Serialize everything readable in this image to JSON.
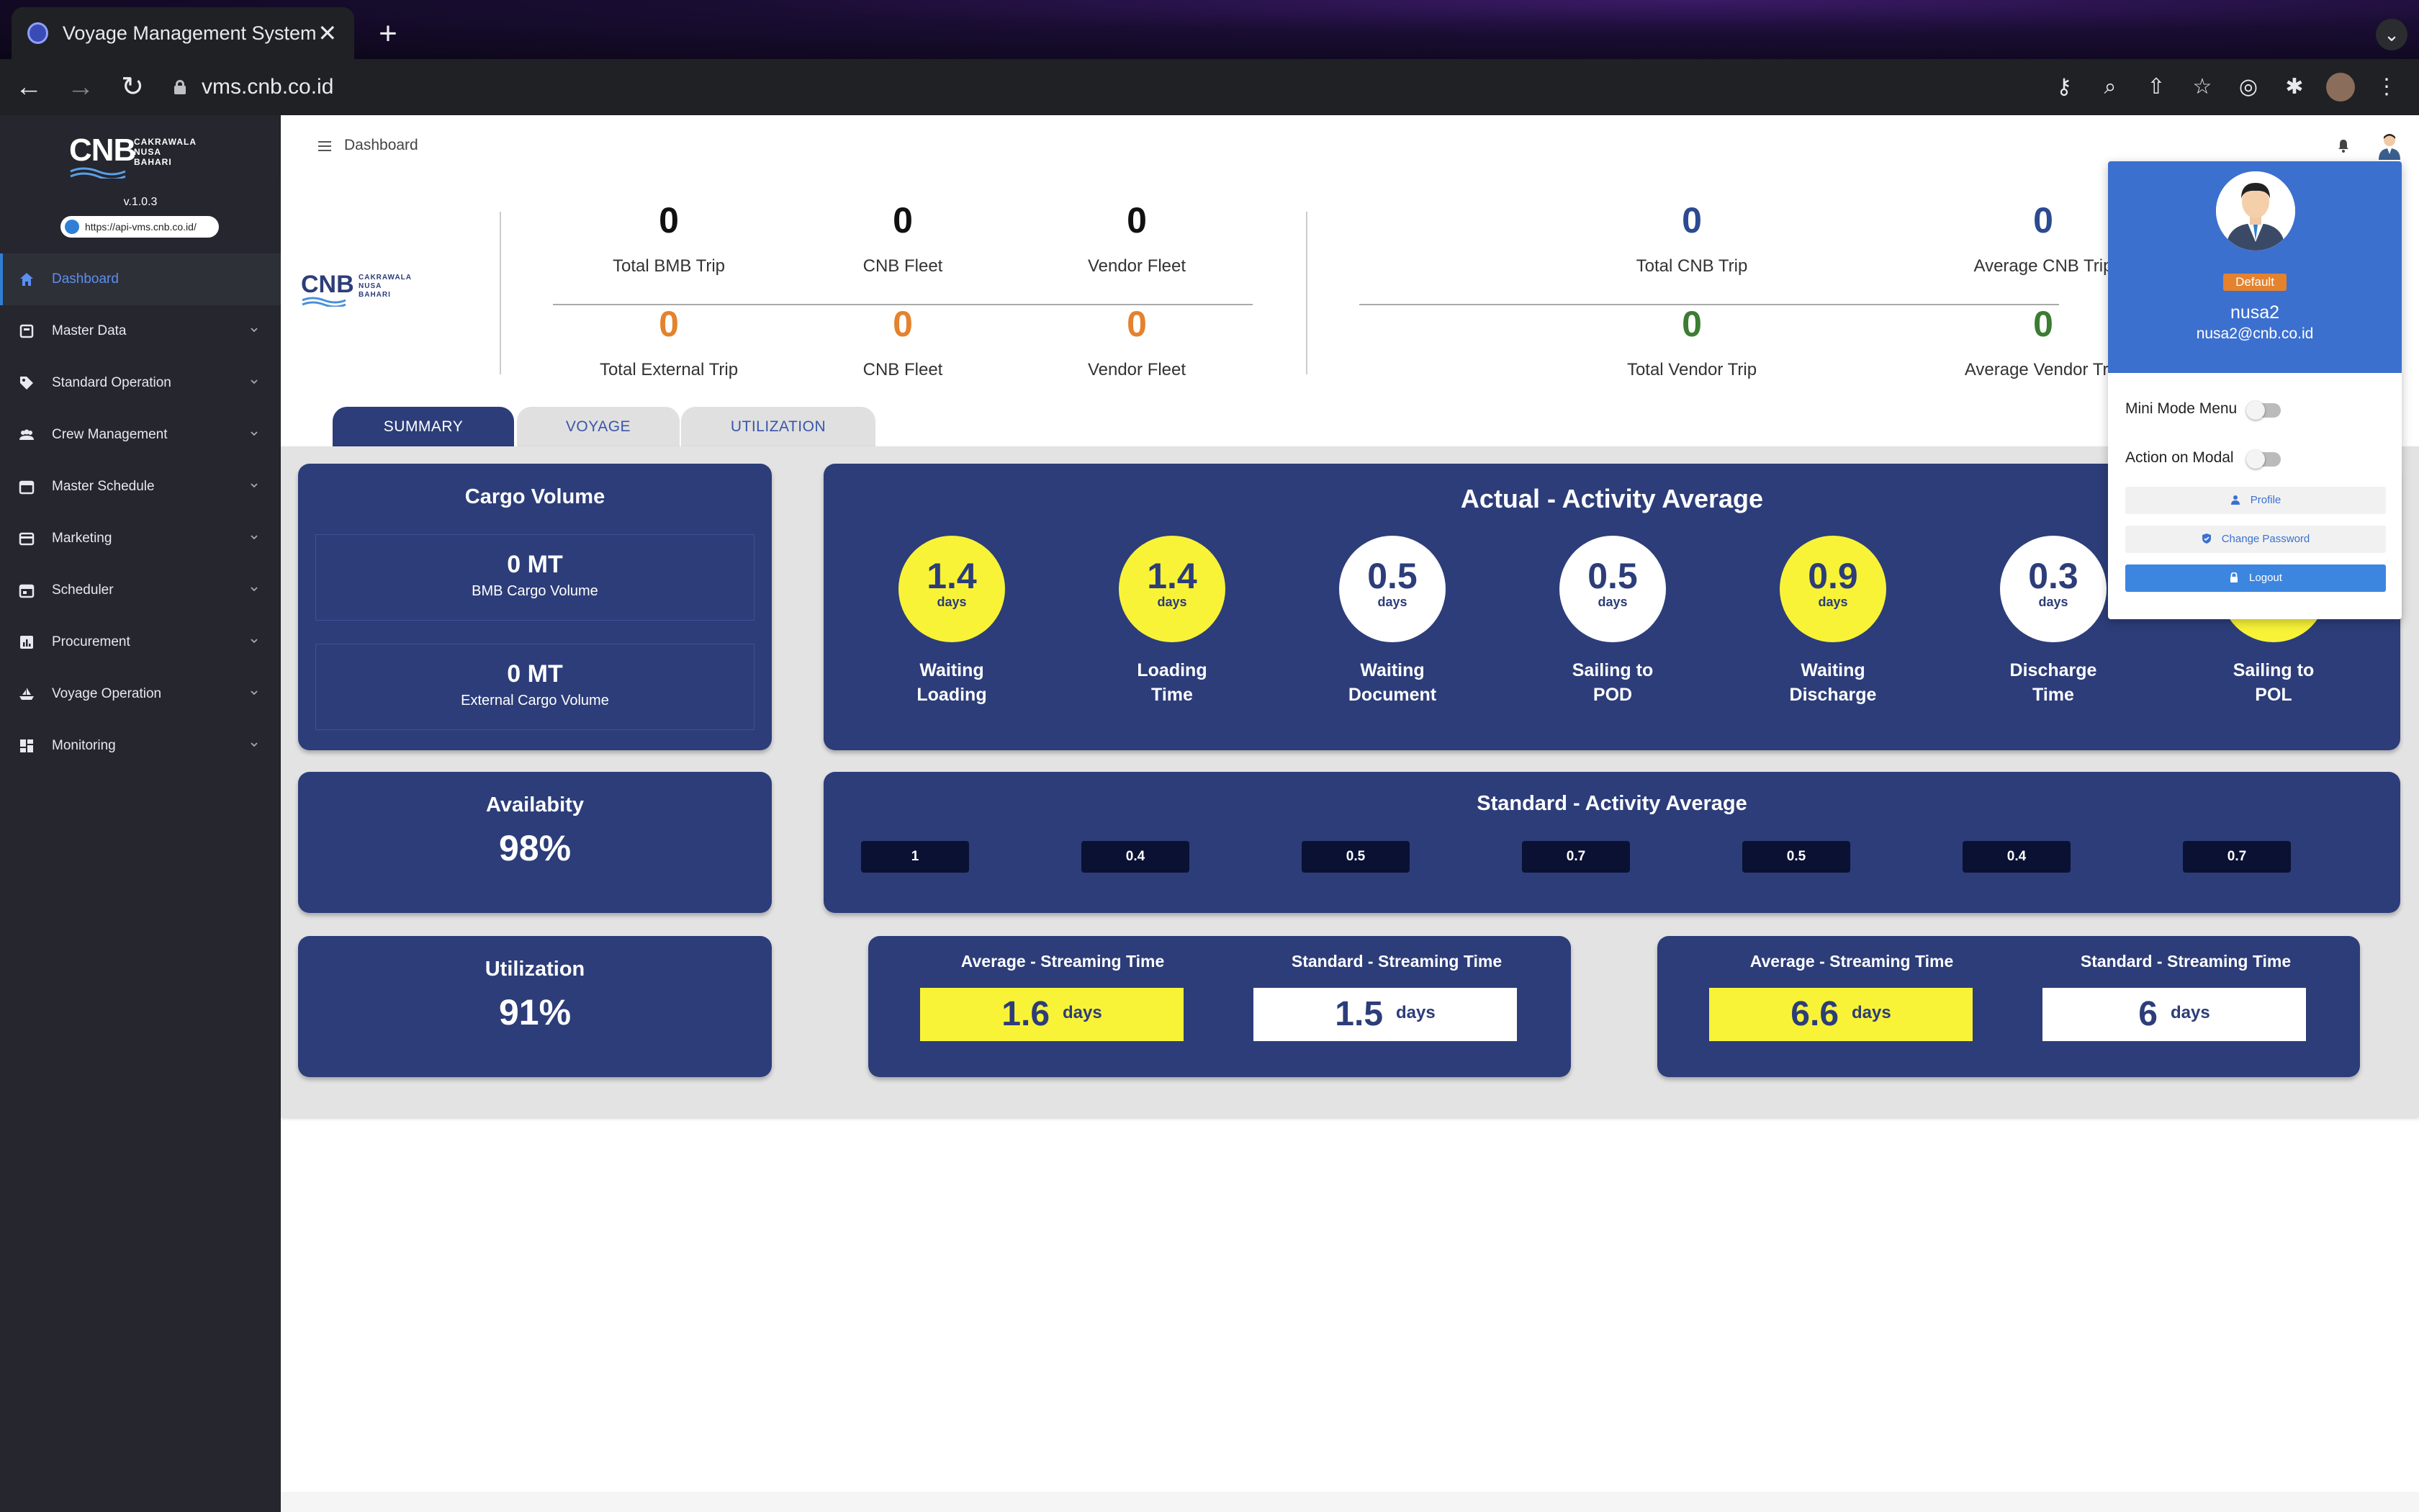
{
  "browser": {
    "tab_title": "Voyage Management System",
    "url": "vms.cnb.co.id"
  },
  "sidebar": {
    "logo_text": "CNB",
    "logo_sub": [
      "CAKRAWALA",
      "NUSA",
      "BAHARI"
    ],
    "version": "v.1.0.3",
    "api_url": "https://api-vms.cnb.co.id/",
    "items": [
      {
        "label": "Dashboard",
        "icon": "home-icon",
        "active": true
      },
      {
        "label": "Master Data",
        "icon": "database-icon"
      },
      {
        "label": "Standard Operation",
        "icon": "tag-icon"
      },
      {
        "label": "Crew Management",
        "icon": "people-icon"
      },
      {
        "label": "Master Schedule",
        "icon": "calendar-icon"
      },
      {
        "label": "Marketing",
        "icon": "card-icon"
      },
      {
        "label": "Scheduler",
        "icon": "calendar-check-icon"
      },
      {
        "label": "Procurement",
        "icon": "chart-icon"
      },
      {
        "label": "Voyage Operation",
        "icon": "ship-icon"
      },
      {
        "label": "Monitoring",
        "icon": "grid-icon"
      }
    ]
  },
  "header": {
    "breadcrumb": "Dashboard"
  },
  "stats": {
    "group1_top": [
      {
        "value": "0",
        "label": "Total BMB Trip"
      },
      {
        "value": "0",
        "label": "CNB Fleet"
      },
      {
        "value": "0",
        "label": "Vendor Fleet"
      }
    ],
    "group1_bottom": [
      {
        "value": "0",
        "label": "Total External Trip"
      },
      {
        "value": "0",
        "label": "CNB Fleet"
      },
      {
        "value": "0",
        "label": "Vendor Fleet"
      }
    ],
    "group2_top": [
      {
        "value": "0",
        "label": "Total CNB Trip"
      },
      {
        "value": "0",
        "label": "Average CNB Trip"
      }
    ],
    "group2_bottom": [
      {
        "value": "0",
        "label": "Total Vendor Trip"
      },
      {
        "value": "0",
        "label": "Average Vendor Trip"
      }
    ]
  },
  "tabs": [
    "SUMMARY",
    "VOYAGE",
    "UTILIZATION"
  ],
  "cargo": {
    "title": "Cargo Volume",
    "bmb_value": "0 MT",
    "bmb_label": "BMB Cargo Volume",
    "ext_value": "0 MT",
    "ext_label": "External Cargo Volume"
  },
  "availability": {
    "title": "Availabity",
    "value": "98%"
  },
  "utilization": {
    "title": "Utilization",
    "value": "91%"
  },
  "actual": {
    "title": "Actual - Activity Average",
    "unit": "days",
    "items": [
      {
        "value": "1.4",
        "label_line1": "Waiting",
        "label_line2": "Loading",
        "highlight": true
      },
      {
        "value": "1.4",
        "label_line1": "Loading",
        "label_line2": "Time",
        "highlight": true
      },
      {
        "value": "0.5",
        "label_line1": "Waiting",
        "label_line2": "Document",
        "highlight": false
      },
      {
        "value": "0.5",
        "label_line1": "Sailing to",
        "label_line2": "POD",
        "highlight": false
      },
      {
        "value": "0.9",
        "label_line1": "Waiting",
        "label_line2": "Discharge",
        "highlight": true
      },
      {
        "value": "0.3",
        "label_line1": "Discharge",
        "label_line2": "Time",
        "highlight": false
      },
      {
        "value": "",
        "label_line1": "Sailing to",
        "label_line2": "POL",
        "highlight": true
      }
    ]
  },
  "standard": {
    "title": "Standard - Activity Average",
    "values": [
      "1",
      "0.4",
      "0.5",
      "0.7",
      "0.5",
      "0.4",
      "0.7"
    ]
  },
  "streaming": [
    {
      "avg_title": "Average - Streaming Time",
      "avg_value": "1.6",
      "avg_unit": "days",
      "std_title": "Standard - Streaming Time",
      "std_value": "1.5",
      "std_unit": "days"
    },
    {
      "avg_title": "Average - Streaming Time",
      "avg_value": "6.6",
      "avg_unit": "days",
      "std_title": "Standard - Streaming Time",
      "std_value": "6",
      "std_unit": "days"
    }
  ],
  "profile": {
    "badge": "Default",
    "name": "nusa2",
    "email": "nusa2@cnb.co.id",
    "mini_mode_label": "Mini Mode Menu",
    "action_modal_label": "Action on Modal",
    "profile_btn": "Profile",
    "change_password_btn": "Change Password",
    "logout_btn": "Logout"
  },
  "colors": {
    "panel": "#2c3d79",
    "highlight_yellow": "#f8f337",
    "accent_orange": "#e4822e",
    "accent_green": "#3b7d32",
    "sidebar": "#25262e",
    "dropdown_header": "#3c70cf"
  }
}
